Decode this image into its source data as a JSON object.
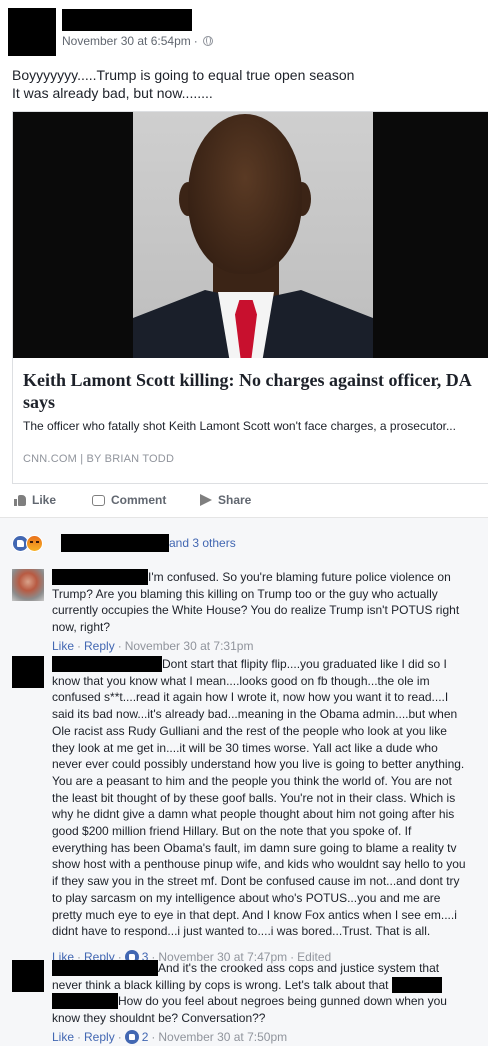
{
  "post": {
    "timestamp": "November 30 at 6:54pm",
    "text_lines": [
      "Boyyyyyyy.....Trump is going to equal true open season",
      "It was already bad, but now........"
    ],
    "link": {
      "title": "Keith Lamont Scott killing: No charges against officer, DA says",
      "description": "The officer who fatally shot Keith Lamont Scott won't face charges, a prosecutor...",
      "source": "CNN.COM | BY BRIAN TODD"
    },
    "actions": {
      "like": "Like",
      "comment": "Comment",
      "share": "Share"
    }
  },
  "reactions": {
    "others": "and 3 others"
  },
  "comments": [
    {
      "lines": [
        "I'm confused. So you're blaming future police violence on",
        "Trump? Are you blaming this killing on Trump too or the guy who actually",
        "currently occupies the White House? You do realize Trump isn't POTUS right",
        "now, right?"
      ],
      "like": "Like",
      "reply": "Reply",
      "time": "November 30 at 7:31pm"
    },
    {
      "lines": [
        "Dont start that flipity flip....you graduated like I did so I",
        "know that you know what I mean....looks good on fb though...the ole im",
        "confused s**t....read it again how I wrote it, now how you want it to read....I",
        "said its bad now...it's already bad...meaning in the Obama admin....but when",
        "Ole racist ass Rudy Gulliani and the rest of the people who look at you like",
        "they look at me get in....it will be 30 times worse. Yall act like a dude who",
        "never ever could possibly understand how you live is going to better anything.",
        "You are a peasant to him and the people you think the world of. You are not",
        "the least bit thought of by these goof balls. You're not in their class. Which is",
        "why he didnt give a damn what people thought about him not going after his",
        "good $200 million friend Hillary. But on the note that you spoke of. If",
        "everything has been Obama's fault, im damn sure going to blame a reality tv",
        "show host with a penthouse pinup wife, and kids who wouldnt say hello to you",
        "if they saw you in the street mf. Dont be confused cause im not...and dont try",
        "to play sarcasm on my intelligence about who's POTUS...you and me are",
        "pretty much eye to eye in that dept. And I know Fox antics when I see em....i",
        "didnt have to respond...i just wanted to....i was bored...Trust. That is all."
      ],
      "like": "Like",
      "reply": "Reply",
      "like_count": "3",
      "time": "November 30 at 7:47pm",
      "edited": "Edited"
    },
    {
      "line1": "And it's the crooked ass cops and justice system that",
      "line2": "never think a black killing by cops is wrong. Let's talk about that",
      "line3": "How do you feel about negroes being gunned down when you",
      "line4": "know they shouldnt be? Conversation??",
      "like": "Like",
      "reply": "Reply",
      "like_count": "2",
      "time": "November 30 at 7:50pm"
    }
  ]
}
